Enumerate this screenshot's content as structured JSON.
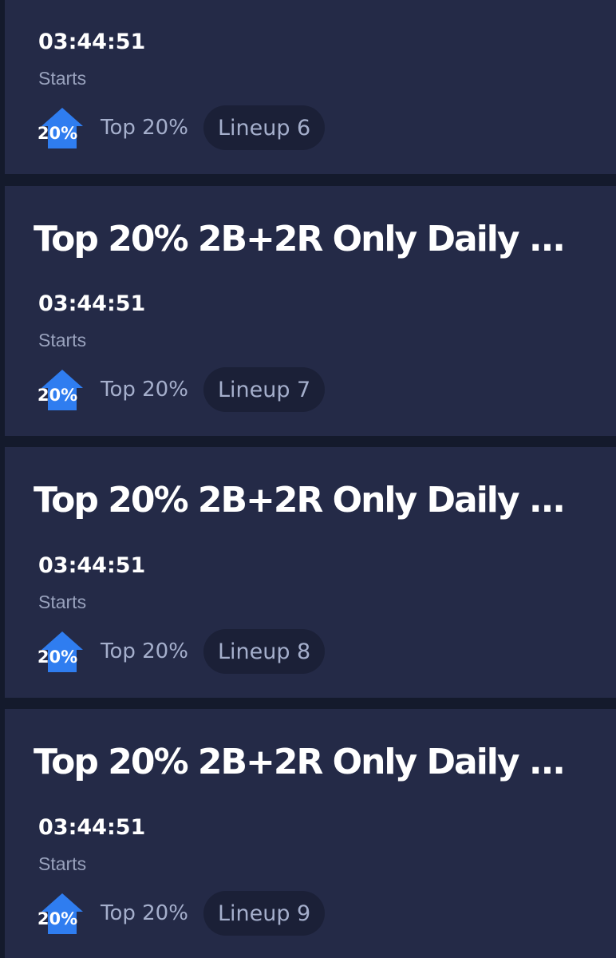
{
  "contests": [
    {
      "title": "",
      "time": "03:44:51",
      "status": "Starts",
      "badge_text": "20%",
      "prize": "Top 20%",
      "lineup": "Lineup 6"
    },
    {
      "title": "Top 20% 2B+2R Only Daily ...",
      "time": "03:44:51",
      "status": "Starts",
      "badge_text": "20%",
      "prize": "Top 20%",
      "lineup": "Lineup 7"
    },
    {
      "title": "Top 20% 2B+2R Only Daily ...",
      "time": "03:44:51",
      "status": "Starts",
      "badge_text": "20%",
      "prize": "Top 20%",
      "lineup": "Lineup 8"
    },
    {
      "title": "Top 20% 2B+2R Only Daily ...",
      "time": "03:44:51",
      "status": "Starts",
      "badge_text": "20%",
      "prize": "Top 20%",
      "lineup": "Lineup 9"
    }
  ],
  "colors": {
    "page_background": "#141a2c",
    "card_background": "#242a47",
    "chip_background": "#1b2037",
    "badge_blue": "#2f7df0",
    "muted_text": "#a5afcc"
  },
  "icons": {
    "badge": "top-20-percent-badge-icon"
  }
}
